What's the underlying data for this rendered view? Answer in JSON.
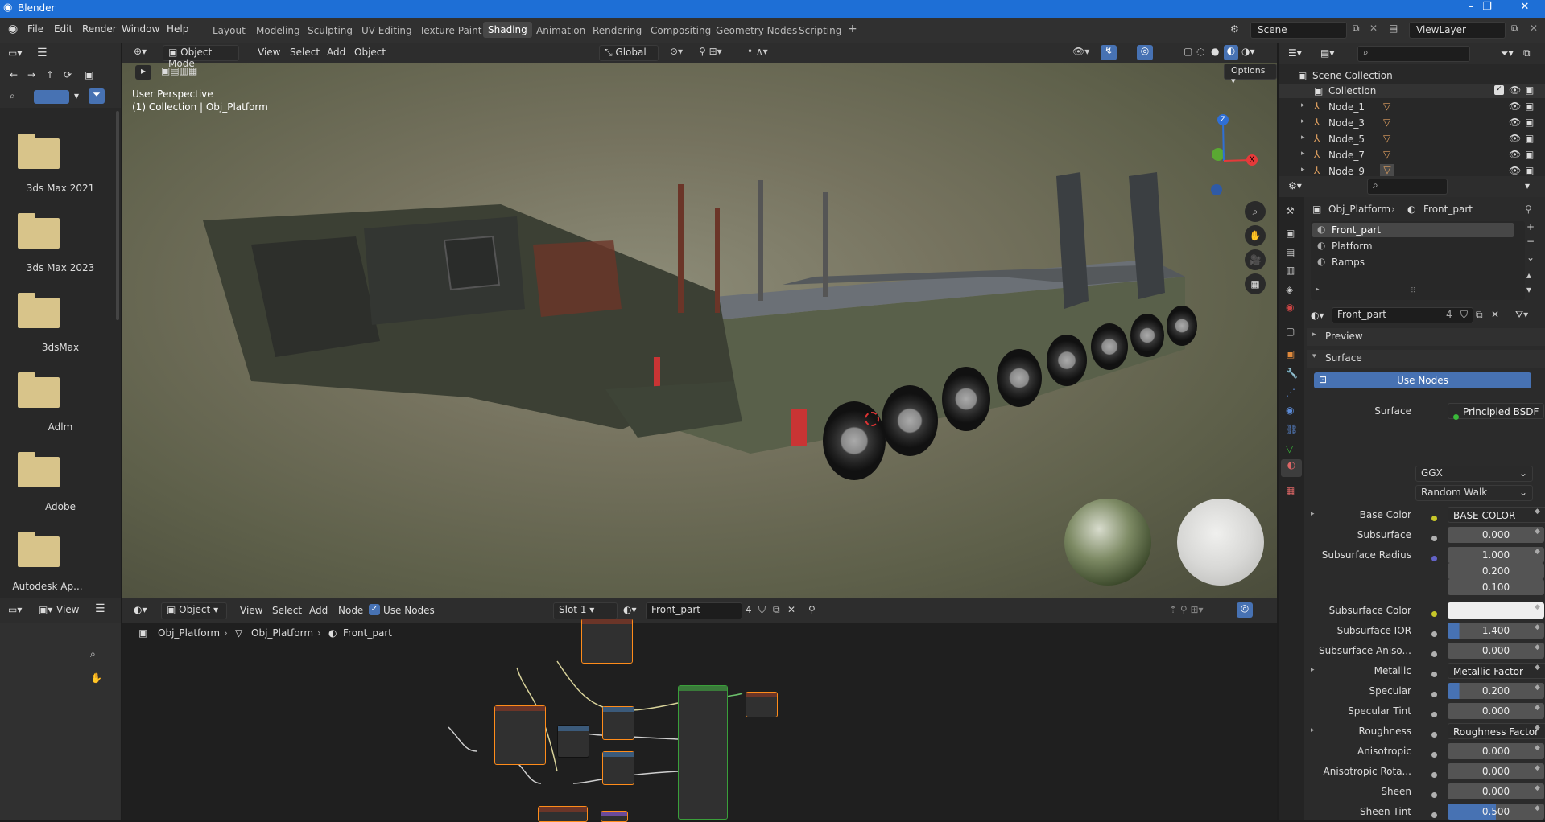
{
  "app": {
    "title": "Blender"
  },
  "menus": [
    "File",
    "Edit",
    "Render",
    "Window",
    "Help"
  ],
  "workspaces": [
    "Layout",
    "Modeling",
    "Sculpting",
    "UV Editing",
    "Texture Paint",
    "Shading",
    "Animation",
    "Rendering",
    "Compositing",
    "Geometry Nodes",
    "Scripting"
  ],
  "active_workspace": "Shading",
  "scene": {
    "name": "Scene",
    "view_layer": "ViewLayer"
  },
  "viewport": {
    "mode": "Object Mode",
    "menus": [
      "View",
      "Select",
      "Add",
      "Object"
    ],
    "transform": "Global",
    "options": "Options",
    "perspective": "User Perspective",
    "collection_info": "(1) Collection | Obj_Platform"
  },
  "file_browser": {
    "folders": [
      "3ds Max 2021",
      "3ds Max 2023",
      "3dsMax",
      "Adlm",
      "Adobe",
      "Autodesk Ap..."
    ]
  },
  "node_editor": {
    "type": "Object",
    "menus": [
      "View",
      "Select",
      "Add",
      "Node"
    ],
    "use_nodes": "Use Nodes",
    "slot": "Slot 1",
    "material": "Front_part",
    "users": "4",
    "breadcrumb": [
      "Obj_Platform",
      "Obj_Platform",
      "Front_part"
    ],
    "left_view": "View"
  },
  "outliner": {
    "root": "Scene Collection",
    "collection": "Collection",
    "items": [
      "Node_1",
      "Node_3",
      "Node_5",
      "Node_7",
      "Node_9"
    ]
  },
  "properties": {
    "breadcrumb": [
      "Obj_Platform",
      "Front_part"
    ],
    "slots": [
      "Front_part",
      "Platform",
      "Ramps"
    ],
    "material_name": "Front_part",
    "material_users": "4",
    "sections": {
      "preview": "Preview",
      "surface": "Surface"
    },
    "use_nodes": "Use Nodes",
    "surface_label": "Surface",
    "surface_value": "Principled BSDF",
    "distribution": "GGX",
    "subsurface_method": "Random Walk",
    "rows": [
      {
        "label": "Base Color",
        "value": "BASE COLOR",
        "kind": "link"
      },
      {
        "label": "Subsurface",
        "value": "0.000",
        "kind": "num"
      },
      {
        "label": "Subsurface Radius",
        "value": "1.000",
        "kind": "num"
      },
      {
        "label": "",
        "value": "0.200",
        "kind": "num"
      },
      {
        "label": "",
        "value": "0.100",
        "kind": "num"
      },
      {
        "label": "Subsurface Color",
        "value": "",
        "kind": "color"
      },
      {
        "label": "Subsurface IOR",
        "value": "1.400",
        "kind": "num"
      },
      {
        "label": "Subsurface Aniso...",
        "value": "0.000",
        "kind": "num"
      },
      {
        "label": "Metallic",
        "value": "Metallic Factor",
        "kind": "link"
      },
      {
        "label": "Specular",
        "value": "0.200",
        "kind": "num"
      },
      {
        "label": "Specular Tint",
        "value": "0.000",
        "kind": "num"
      },
      {
        "label": "Roughness",
        "value": "Roughness Factor",
        "kind": "link"
      },
      {
        "label": "Anisotropic",
        "value": "0.000",
        "kind": "num"
      },
      {
        "label": "Anisotropic Rota...",
        "value": "0.000",
        "kind": "num"
      },
      {
        "label": "Sheen",
        "value": "0.000",
        "kind": "num"
      },
      {
        "label": "Sheen Tint",
        "value": "0.500",
        "kind": "num"
      }
    ]
  },
  "colors": {
    "accent": "#4772b3",
    "title_bar": "#1e6fd6",
    "selected_node": "#ff8c1a"
  }
}
